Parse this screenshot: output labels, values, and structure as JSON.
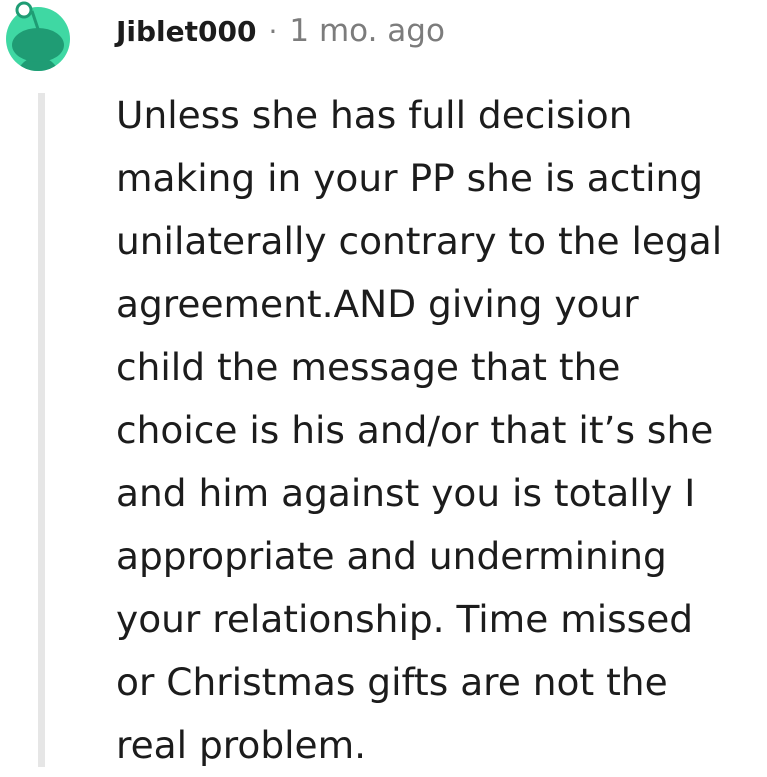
{
  "comment": {
    "author": "Jiblet000",
    "separator": "·",
    "timestamp": "1 mo. ago",
    "avatar_icon": "reddit-snoo-avatar-icon",
    "avatar_color": "#3fd8a3",
    "body_lines": [
      "Unless she has full decision",
      "making in your PP she is acting",
      "unilaterally contrary to the legal",
      "agreement.AND giving your",
      "child the message that the",
      "choice is his and/or that it’s she",
      "and him against you is totally I",
      "appropriate and undermining",
      "your relationship. Time missed",
      "or Christmas gifts are not the",
      "real problem."
    ]
  }
}
